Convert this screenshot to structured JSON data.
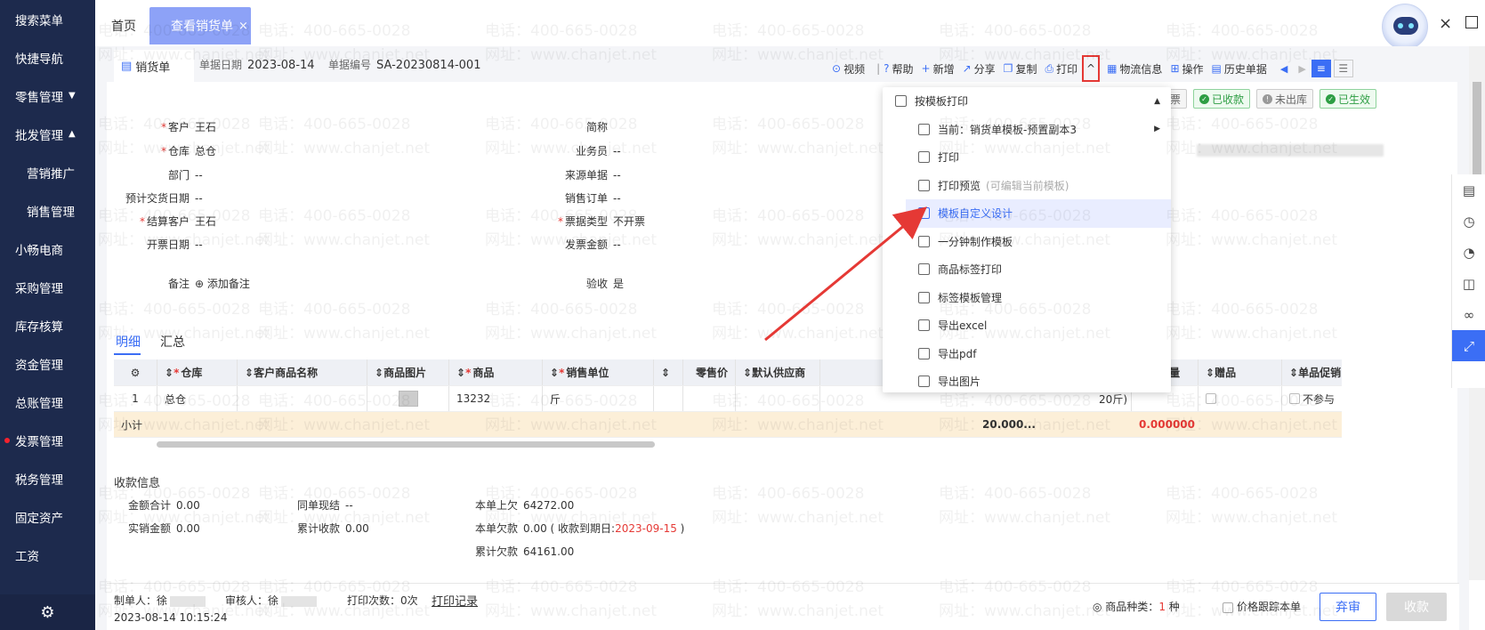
{
  "sidebar": {
    "items": [
      {
        "label": "搜索菜单",
        "caret": ""
      },
      {
        "label": "快捷导航",
        "caret": ""
      },
      {
        "label": "零售管理",
        "caret": "▼"
      },
      {
        "label": "批发管理",
        "caret": "▲"
      },
      {
        "label": "营销推广",
        "caret": "",
        "sub": true
      },
      {
        "label": "销售管理",
        "caret": "",
        "sub": true
      },
      {
        "label": "小畅电商",
        "caret": ""
      },
      {
        "label": "采购管理",
        "caret": ""
      },
      {
        "label": "库存核算",
        "caret": ""
      },
      {
        "label": "资金管理",
        "caret": ""
      },
      {
        "label": "总账管理",
        "caret": ""
      },
      {
        "label": "发票管理",
        "caret": "",
        "dot": true
      },
      {
        "label": "税务管理",
        "caret": ""
      },
      {
        "label": "固定资产",
        "caret": ""
      },
      {
        "label": "工资",
        "caret": ""
      }
    ]
  },
  "tabs": {
    "home": "首页",
    "active": "查看销货单",
    "close": "×"
  },
  "window": {
    "close": "×"
  },
  "doc": {
    "tab_label": "销货单",
    "date_label": "单据日期",
    "date": "2023-08-14",
    "no_label": "单据编号",
    "no": "SA-20230814-001"
  },
  "toolbar": {
    "video": "视频",
    "sep": "|",
    "help": "帮助",
    "add": "新增",
    "share": "分享",
    "copy": "复制",
    "print": "打印",
    "logistics": "物流信息",
    "ops": "操作",
    "history": "历史单据"
  },
  "badges": [
    {
      "label": "未开票",
      "type": "grey",
      "mark": "!"
    },
    {
      "label": "已收款",
      "type": "green",
      "mark": "✓"
    },
    {
      "label": "未出库",
      "type": "grey",
      "mark": "!"
    },
    {
      "label": "已生效",
      "type": "green",
      "mark": "✓"
    }
  ],
  "form": {
    "customer_label": "客户",
    "customer": "王石",
    "warehouse_label": "仓库",
    "warehouse": "总仓",
    "dept_label": "部门",
    "dept": "--",
    "delivery_label": "预计交货日期",
    "delivery": "--",
    "settle_label": "结算客户",
    "settle": "王石",
    "invoice_date_label": "开票日期",
    "invoice_date": "--",
    "remark_label": "备注",
    "remark_add": "添加备注",
    "short_label": "简称",
    "short": "",
    "salesman_label": "业务员",
    "salesman": "--",
    "source_label": "来源单据",
    "source": "--",
    "order_label": "销售订单",
    "order": "--",
    "ticket_label": "票据类型",
    "ticket": "不开票",
    "amount_label": "发票金额",
    "amount": "--",
    "check_label": "验收",
    "check": "是"
  },
  "subtabs": {
    "detail": "明细",
    "summary": "汇总"
  },
  "table": {
    "headers": [
      "仓库",
      "客户商品名称",
      "商品图片",
      "商品",
      "销售单位",
      "",
      "零售价",
      "默认供应商",
      "可用量",
      "赠品",
      "单品促销"
    ],
    "row": {
      "no": "1",
      "warehouse": "总仓",
      "product": "13232",
      "unit": "斤",
      "qty_tail": "20斤)",
      "promo": "不参与"
    },
    "subtotal": {
      "label": "小计",
      "qty": "20.000...",
      "avail": "0.000000"
    }
  },
  "payment": {
    "title": "收款信息",
    "total_label": "金额合计",
    "total": "0.00",
    "same_label": "同单现结",
    "same": "--",
    "last_label": "本单上欠",
    "last": "64272.00",
    "actual_label": "实销金额",
    "actual": "0.00",
    "cum_recv_label": "累计收款",
    "cum_recv": "0.00",
    "owe_label": "本单欠款",
    "owe": "0.00",
    "due_prefix": "( 收款到期日:",
    "due_date": "2023-09-15",
    "due_suffix": ")",
    "cum_owe_label": "累计欠款",
    "cum_owe": "64161.00"
  },
  "dropdown": {
    "header": "按模板打印",
    "items": [
      {
        "label": "当前：销货单模板-预置副本3",
        "hint": "",
        "arrow": "▶"
      },
      {
        "label": "打印",
        "hint": ""
      },
      {
        "label": "打印预览",
        "hint": "(可编辑当前模板)"
      },
      {
        "label": "模板自定义设计",
        "hint": "",
        "active": true
      },
      {
        "label": "一分钟制作模板",
        "hint": ""
      },
      {
        "label": "商品标签打印",
        "hint": ""
      },
      {
        "label": "标签模板管理",
        "hint": ""
      },
      {
        "label": "导出excel",
        "hint": ""
      },
      {
        "label": "导出pdf",
        "hint": ""
      },
      {
        "label": "导出图片",
        "hint": ""
      }
    ]
  },
  "footer": {
    "maker_label": "制单人：",
    "maker": "徐",
    "reviewer_label": "审核人：",
    "reviewer": "徐",
    "print_count_label": "打印次数：",
    "print_count": "0次",
    "print_log": "打印记录",
    "timestamp": "2023-08-14 10:15:24",
    "kinds_label": "商品种类：",
    "kinds": "1",
    "kinds_unit": "种",
    "price_track": "价格跟踪本单",
    "abandon": "弃审",
    "receive": "收款"
  },
  "watermark": {
    "tel": "电话：400-665-0028",
    "web": "网址：www.chanjet.net"
  },
  "colors": {
    "sidebar": "#1d2a4d",
    "accent": "#3b6ef5",
    "active_tab": "#8da2f7",
    "danger": "#e53935",
    "success": "#2e9e44"
  }
}
